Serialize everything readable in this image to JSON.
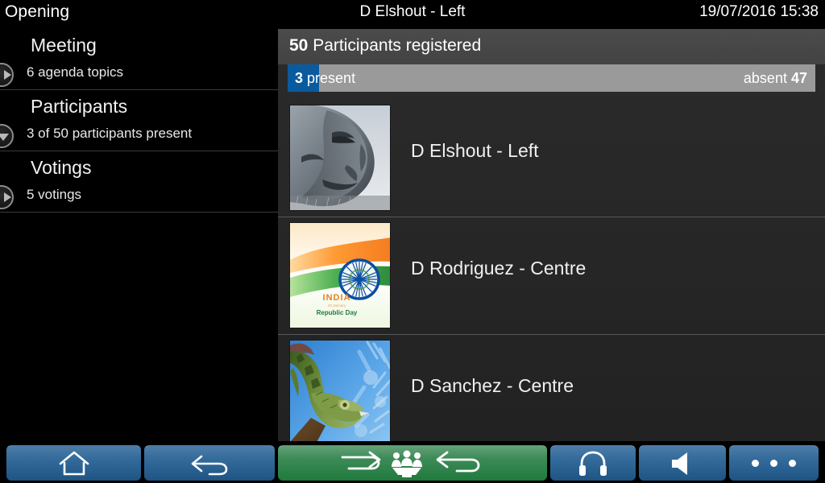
{
  "topbar": {
    "left_label": "Opening",
    "center_label": "D Elshout - Left",
    "datetime": "19/07/2016 15:38"
  },
  "sidebar": {
    "items": [
      {
        "title": "Meeting",
        "subtitle": "6 agenda topics",
        "icon": "chevron-right-circle-icon",
        "expanded": false
      },
      {
        "title": "Participants",
        "subtitle": "3 of 50 participants present",
        "icon": "chevron-down-circle-icon",
        "expanded": true
      },
      {
        "title": "Votings",
        "subtitle": "5 votings",
        "icon": "chevron-right-circle-icon",
        "expanded": false
      }
    ]
  },
  "main": {
    "header_count": "50",
    "header_label": "Participants registered",
    "progress": {
      "present_count": "3",
      "present_label": "present",
      "absent_label": "absent",
      "absent_count": "47",
      "fill_percent": 6,
      "fill_color": "#0a5b9e",
      "track_color": "#9a9a9a"
    },
    "participants": [
      {
        "name": "D Elshout - Left",
        "thumb": "stone-face-sculpture-photo"
      },
      {
        "name": "D Rodriguez - Centre",
        "thumb": "india-republic-day-flag-photo"
      },
      {
        "name": "D Sanchez - Centre",
        "thumb": "green-iguana-photo"
      }
    ]
  },
  "toolbar": {
    "buttons": [
      {
        "name": "home-button",
        "icon": "home-icon",
        "color": "blue"
      },
      {
        "name": "back-button",
        "icon": "back-arrow-icon",
        "color": "blue"
      },
      {
        "name": "request-to-speak-button",
        "icon": "speak-queue-group-icon",
        "color": "green"
      },
      {
        "name": "headphones-button",
        "icon": "headphones-icon",
        "color": "blue"
      },
      {
        "name": "volume-button",
        "icon": "speaker-icon",
        "color": "blue"
      },
      {
        "name": "more-options-button",
        "icon": "ellipsis-icon",
        "color": "blue"
      }
    ]
  },
  "colors": {
    "background": "#000000",
    "panel": "#272727",
    "header_band": "#474747",
    "accent_blue": "#0a5b9e",
    "accent_green": "#2f8a4d"
  }
}
